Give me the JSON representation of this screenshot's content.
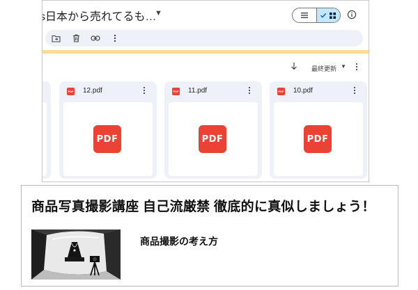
{
  "drive": {
    "folder_title": "s日本から売れてるも…",
    "toolbar": {
      "icons": [
        "folder-move-icon",
        "trash-icon",
        "link-icon",
        "more-vert-icon"
      ]
    },
    "sort": {
      "label": "最終更新"
    },
    "files": [
      {
        "name": "12.pdf",
        "thumb_label": "PDF",
        "icon_label": "PDF"
      },
      {
        "name": "11.pdf",
        "thumb_label": "PDF",
        "icon_label": "PDF"
      },
      {
        "name": "10.pdf",
        "thumb_label": "PDF",
        "icon_label": "PDF"
      }
    ],
    "colors": {
      "pdf_red": "#ea4335",
      "toggle_active": "#c2e7ff",
      "banner": "#f9dc92",
      "surface": "#eef1f8"
    }
  },
  "course": {
    "title": "商品写真撮影講座 自己流厳禁 徹底的に真似しましょう！",
    "subtitle": "商品撮影の考え方"
  }
}
